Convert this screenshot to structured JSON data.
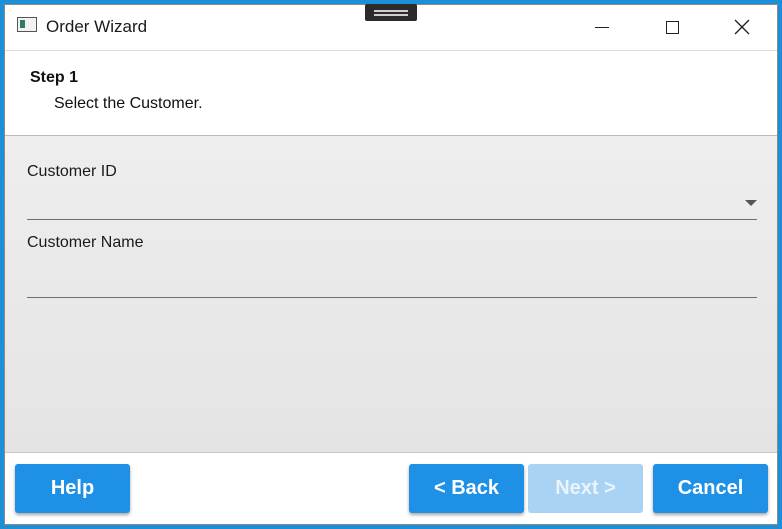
{
  "window": {
    "title": "Order Wizard",
    "icon": "app-window-icon",
    "controls": [
      "minimize-icon",
      "maximize-icon",
      "close-icon"
    ]
  },
  "header": {
    "step_title": "Step 1",
    "step_description": "Select the Customer."
  },
  "form": {
    "customer_id": {
      "label": "Customer ID",
      "value": ""
    },
    "customer_name": {
      "label": "Customer Name",
      "value": "",
      "placeholder": ""
    }
  },
  "footer": {
    "help_label": "Help",
    "back_label": "< Back",
    "next_label": "Next >",
    "cancel_label": "Cancel"
  },
  "colors": {
    "accent": "#1e90e6",
    "accent_disabled": "#a9d3f5",
    "content_background": "#e8e8e8",
    "desktop_background": "#1c8fd6"
  }
}
